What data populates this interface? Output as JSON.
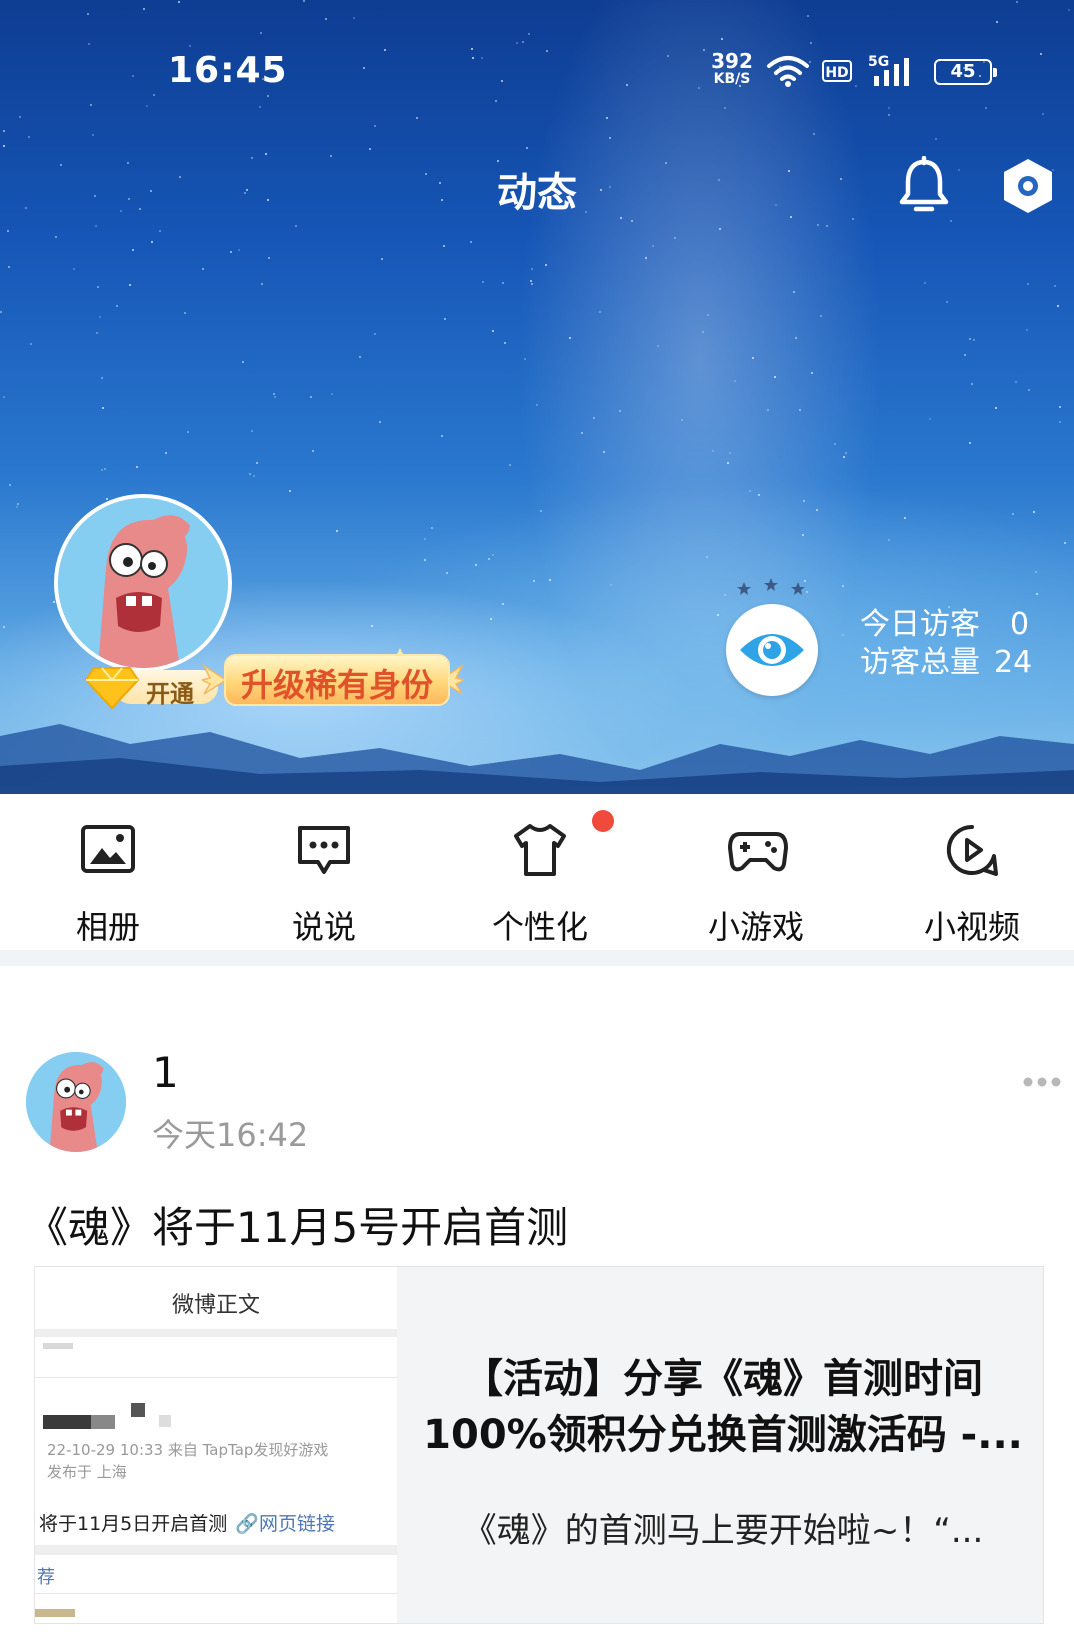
{
  "status_bar": {
    "time": "16:45",
    "net_speed_value": "392",
    "net_speed_unit": "KB/S",
    "hd_label": "HD",
    "network_label": "5G",
    "battery_level": "45"
  },
  "header": {
    "title": "动态"
  },
  "profile": {
    "vip_open_label": "开通",
    "upgrade_label": "升级稀有身份",
    "visitors_today_label": "今日访客",
    "visitors_today_value": "0",
    "visitors_total_label": "访客总量",
    "visitors_total_value": "24"
  },
  "quick_actions": [
    {
      "label": "相册",
      "icon": "photo-album-icon"
    },
    {
      "label": "说说",
      "icon": "chat-bubble-icon"
    },
    {
      "label": "个性化",
      "icon": "tshirt-icon",
      "badge": "red-dot"
    },
    {
      "label": "小游戏",
      "icon": "gamepad-icon"
    },
    {
      "label": "小视频",
      "icon": "play-video-icon"
    }
  ],
  "post": {
    "user_name": "1",
    "time": "今天16:42",
    "text": "《魂》将于11月5号开启首测",
    "link_card": {
      "title_line1": "【活动】分享《魂》首测时间",
      "title_line2": "100%领积分兑换首测激活码 -...",
      "description": "《魂》的首测马上要开始啦~！“...",
      "thumbnail": {
        "header": "微博正文",
        "meta_line1": "22-10-29 10:33  来自 TapTap发现好游戏",
        "meta_line2": "发布于 上海",
        "body": "将于11月5日开启首测",
        "link_text": "网页链接",
        "recommend": "荐"
      }
    }
  },
  "colors": {
    "accent_red": "#f04a3c",
    "link_blue": "#5078b4",
    "upgrade_text": "#e0522a",
    "eye_blue": "#2ea3e6"
  }
}
